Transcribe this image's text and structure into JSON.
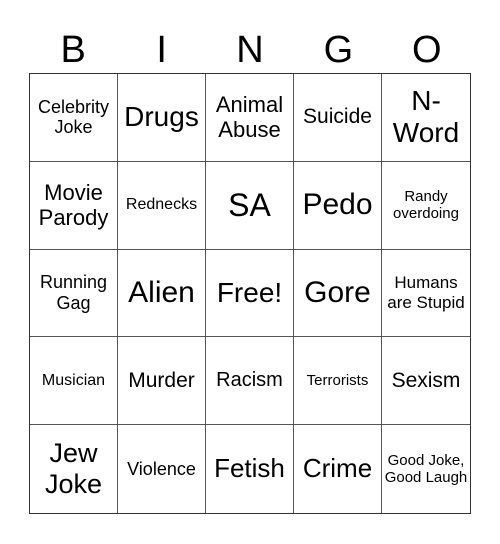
{
  "header": [
    "B",
    "I",
    "N",
    "G",
    "O"
  ],
  "cells": [
    "Celebrity Joke",
    "Drugs",
    "Animal Abuse",
    "Suicide",
    "N-Word",
    "Movie Parody",
    "Rednecks",
    "SA",
    "Pedo",
    "Randy overdoing",
    "Running Gag",
    "Alien",
    "Free!",
    "Gore",
    "Humans are Stupid",
    "Musician",
    "Murder",
    "Racism",
    "Terrorists",
    "Sexism",
    "Jew Joke",
    "Violence",
    "Fetish",
    "Crime",
    "Good Joke, Good Laugh"
  ]
}
